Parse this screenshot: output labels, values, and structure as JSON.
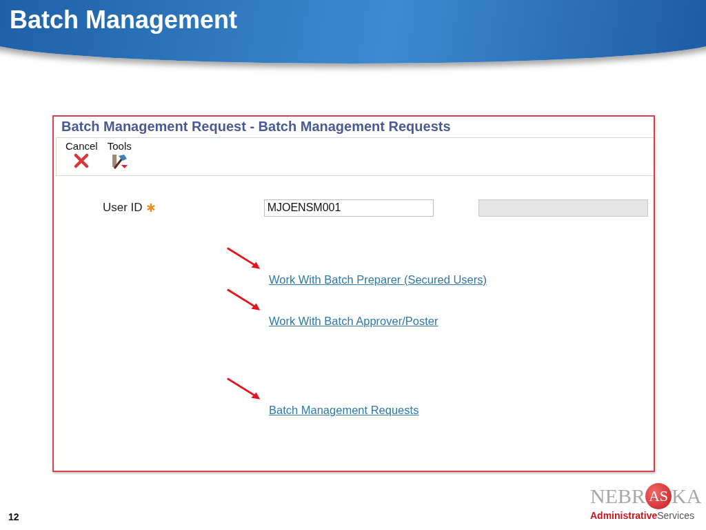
{
  "slide": {
    "title": "Batch Management",
    "number": "12"
  },
  "form": {
    "title": "Batch Management Request - Batch Management Requests",
    "toolbar": [
      {
        "kind": "cancel",
        "label": "Cancel"
      },
      {
        "kind": "tools",
        "label": "Tools"
      }
    ],
    "field": {
      "label": "User ID",
      "required": true,
      "value": "MJOENSM001"
    },
    "description_field": {
      "disabled": true
    },
    "links": [
      {
        "label": "Work With Batch Preparer (Secured Users)",
        "arrow": true
      },
      {
        "label": "Work With Batch Approver/Poster",
        "arrow": true
      },
      {
        "label": "Batch Management Requests",
        "arrow": true
      }
    ]
  },
  "logo": {
    "state": "NEBR",
    "circle": "AS",
    "end": "KA",
    "agency": "Administrative",
    "suffix": "Services"
  }
}
